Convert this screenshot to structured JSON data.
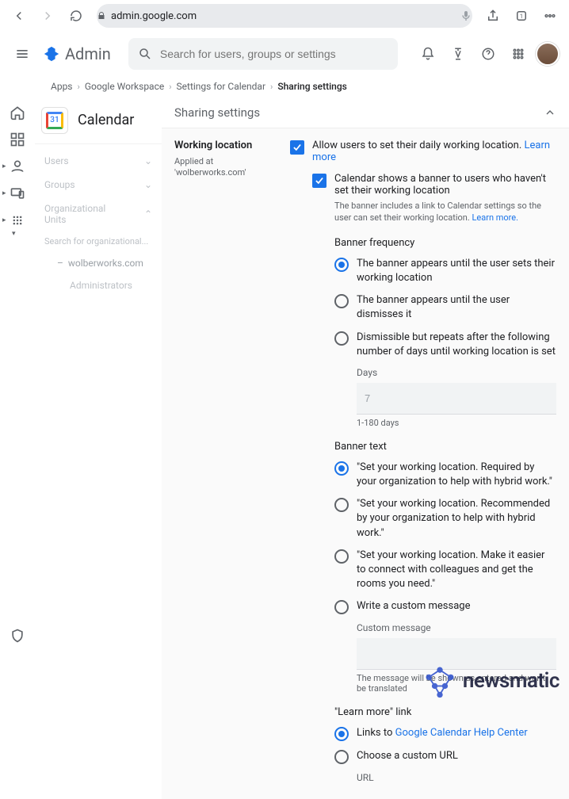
{
  "browser": {
    "url": "admin.google.com"
  },
  "header": {
    "product": "Admin",
    "search_placeholder": "Search for users, groups or settings"
  },
  "breadcrumbs": [
    "Apps",
    "Google Workspace",
    "Settings for Calendar",
    "Sharing settings"
  ],
  "left_panel": {
    "app": "Calendar",
    "cal_badge": "31",
    "items": {
      "users": "Users",
      "groups": "Groups",
      "orgunits": "Organizational Units",
      "search": "Search for organizational...",
      "ou": "wolberworks.com",
      "admins": "Administrators"
    }
  },
  "section": {
    "title": "Sharing settings"
  },
  "wl": {
    "heading": "Working location",
    "applied": "Applied at 'wolberworks.com'",
    "allow": "Allow users to set their daily working location.",
    "banner_chk": "Calendar shows a banner to users who haven't set their working location",
    "banner_help": "The banner includes a link to Calendar settings so the user can set their working location.",
    "learn_more": "Learn more",
    "learn_more_p": "Learn more.",
    "freq": {
      "h": "Banner frequency",
      "o1": "The banner appears until the user sets their working location",
      "o2": "The banner appears until the user dismisses it",
      "o3": "Dismissible but repeats after the following number of days until working location is set",
      "days_lbl": "Days",
      "days_val": "7",
      "days_hint": "1-180 days"
    },
    "text": {
      "h": "Banner text",
      "o1": "\"Set your working location. Required by your organization to help with hybrid work.\"",
      "o2": "\"Set your working location. Recommended by your organization to help with hybrid work.\"",
      "o3": "\"Set your working location. Make it easier to connect with colleagues and get the rooms you need.\"",
      "o4": "Write a custom message",
      "custom_lbl": "Custom message",
      "custom_hint": "The message will be shown as entered and won't be translated"
    },
    "link": {
      "h": "\"Learn more\" link",
      "o1_pre": "Links to ",
      "o1_link": "Google Calendar Help Center",
      "o2": "Choose a custom URL",
      "url_lbl": "URL"
    }
  },
  "watermark": "newsmatic"
}
